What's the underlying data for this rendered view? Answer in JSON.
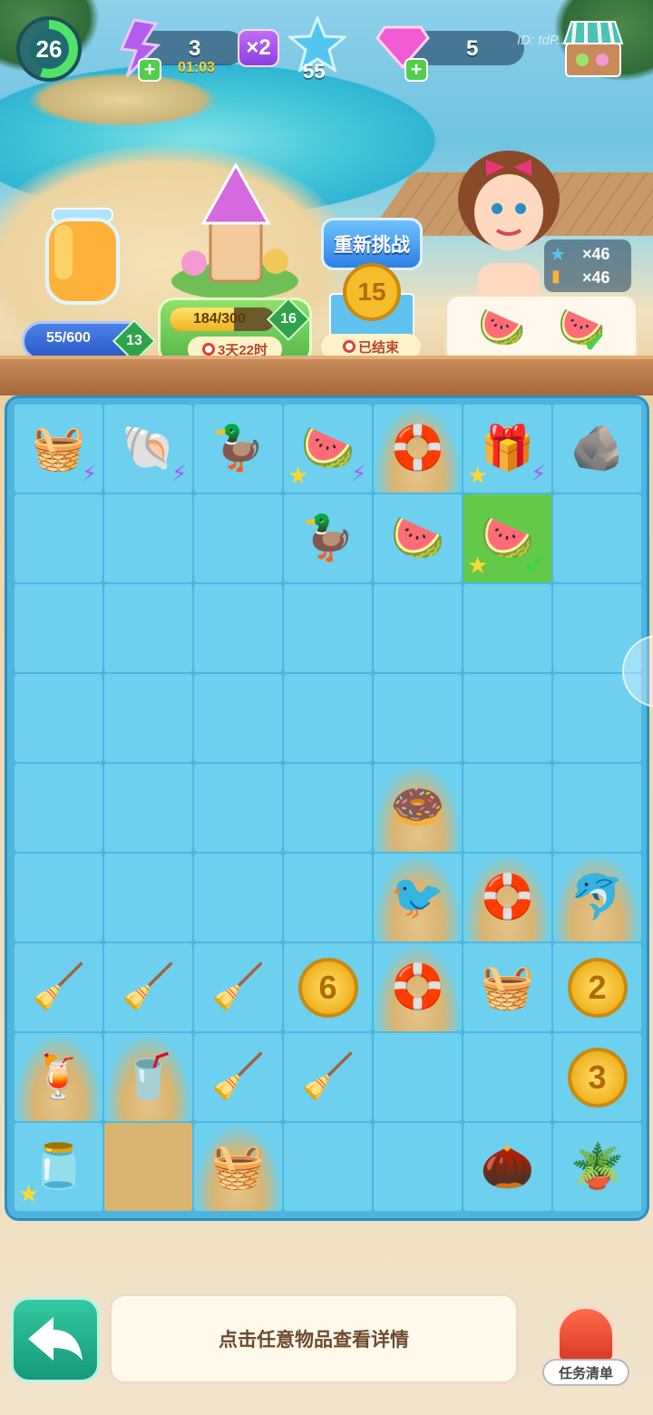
{
  "hud": {
    "level": "26",
    "energy": "3",
    "energy_timer": "01:03",
    "multiplier": "×2",
    "stars": "55",
    "gems": "5",
    "watermark": "ID: tdP..."
  },
  "event": {
    "jar_progress": "55/600",
    "jar_fraction": 0.09,
    "jar_level": "13",
    "tower_progress": "184/300",
    "tower_fraction": 0.61,
    "tower_level": "16",
    "tower_time": "3天22时",
    "retry_label": "重新挑战",
    "retry_coin": "15",
    "ended_label": "已结束"
  },
  "character": {
    "stat_star": "×46",
    "stat_juice": "×46"
  },
  "board": {
    "rows": [
      [
        {
          "icon": "🧺",
          "star": false,
          "bolt": true
        },
        {
          "icon": "🐚",
          "bolt": true
        },
        {
          "icon": "🦆"
        },
        {
          "icon": "🍉",
          "star": true,
          "bolt": true
        },
        {
          "icon": "🛟",
          "sand": true
        },
        {
          "icon": "🎁",
          "star": true,
          "bolt": true
        },
        {
          "icon": "🪨"
        }
      ],
      [
        {
          "icon": ""
        },
        {
          "icon": ""
        },
        {
          "icon": ""
        },
        {
          "icon": "🦆"
        },
        {
          "icon": "🍉"
        },
        {
          "icon": "🍉",
          "star": true,
          "check": true,
          "highlight": true
        },
        {
          "icon": ""
        }
      ],
      [
        {
          "icon": ""
        },
        {
          "icon": ""
        },
        {
          "icon": ""
        },
        {
          "icon": ""
        },
        {
          "icon": ""
        },
        {
          "icon": ""
        },
        {
          "icon": ""
        }
      ],
      [
        {
          "icon": ""
        },
        {
          "icon": ""
        },
        {
          "icon": ""
        },
        {
          "icon": ""
        },
        {
          "icon": ""
        },
        {
          "icon": ""
        },
        {
          "icon": ""
        }
      ],
      [
        {
          "icon": ""
        },
        {
          "icon": ""
        },
        {
          "icon": ""
        },
        {
          "icon": ""
        },
        {
          "icon": "🍩",
          "sand": true
        },
        {
          "icon": ""
        },
        {
          "icon": ""
        }
      ],
      [
        {
          "icon": ""
        },
        {
          "icon": ""
        },
        {
          "icon": ""
        },
        {
          "icon": ""
        },
        {
          "icon": "🐦",
          "sand": true
        },
        {
          "icon": "🛟",
          "sand": true
        },
        {
          "icon": "🐬",
          "sand": true
        }
      ],
      [
        {
          "icon": "🧹"
        },
        {
          "icon": "🧹"
        },
        {
          "icon": "🧹"
        },
        {
          "coin": "6"
        },
        {
          "icon": "🛟",
          "sand": true
        },
        {
          "icon": "🧺"
        },
        {
          "coin": "2"
        }
      ],
      [
        {
          "icon": "🍹",
          "sand": true
        },
        {
          "icon": "🥤",
          "sand": true
        },
        {
          "icon": "🧹"
        },
        {
          "icon": "🧹"
        },
        {
          "icon": ""
        },
        {
          "icon": ""
        },
        {
          "coin": "3"
        }
      ],
      [
        {
          "icon": "🫙",
          "star": true
        },
        {
          "icon": "",
          "sandfull": true
        },
        {
          "icon": "🧺",
          "sand": true
        },
        {
          "icon": ""
        },
        {
          "icon": ""
        },
        {
          "icon": "🌰"
        },
        {
          "icon": "🪴"
        }
      ]
    ]
  },
  "footer": {
    "hint": "点击任意物品查看详情",
    "task_label": "任务清单"
  },
  "colors": {
    "board": "#4eb6de",
    "cell": "#6cd0ee",
    "highlight": "#63c949",
    "accent_green": "#15987a"
  }
}
